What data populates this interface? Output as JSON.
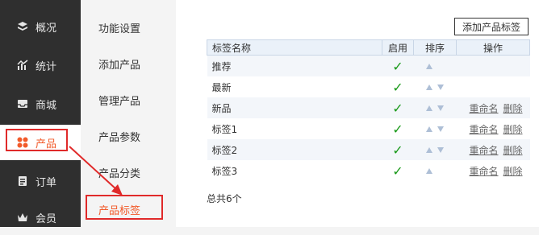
{
  "sidebar": {
    "items": [
      {
        "label": "概况",
        "icon": "layers-icon"
      },
      {
        "label": "统计",
        "icon": "chart-icon"
      },
      {
        "label": "商城",
        "icon": "inbox-icon"
      },
      {
        "label": "产品",
        "icon": "grid-icon"
      },
      {
        "label": "订单",
        "icon": "clipboard-icon"
      },
      {
        "label": "会员",
        "icon": "crown-icon"
      }
    ],
    "active_index": 3,
    "active_color": "#f25a2a"
  },
  "subnav": {
    "items": [
      "功能设置",
      "添加产品",
      "管理产品",
      "产品参数",
      "产品分类",
      "产品标签"
    ],
    "active_index": 5
  },
  "main": {
    "add_button": "添加产品标签",
    "table": {
      "headers": [
        "标签名称",
        "启用",
        "排序",
        "操作"
      ],
      "rows": [
        {
          "name": "推荐",
          "enabled": "✓",
          "sort_up": true,
          "sort_down": false,
          "rename": "",
          "delete": ""
        },
        {
          "name": "最新",
          "enabled": "✓",
          "sort_up": true,
          "sort_down": true,
          "rename": "",
          "delete": ""
        },
        {
          "name": "新品",
          "enabled": "✓",
          "sort_up": true,
          "sort_down": true,
          "rename": "重命名",
          "delete": "删除"
        },
        {
          "name": "标签1",
          "enabled": "✓",
          "sort_up": true,
          "sort_down": true,
          "rename": "重命名",
          "delete": "删除"
        },
        {
          "name": "标签2",
          "enabled": "✓",
          "sort_up": true,
          "sort_down": true,
          "rename": "重命名",
          "delete": "删除"
        },
        {
          "name": "标签3",
          "enabled": "✓",
          "sort_up": true,
          "sort_down": false,
          "rename": "重命名",
          "delete": "删除"
        }
      ]
    },
    "total": "总共6个"
  },
  "annotation_color": "#e02a2a"
}
